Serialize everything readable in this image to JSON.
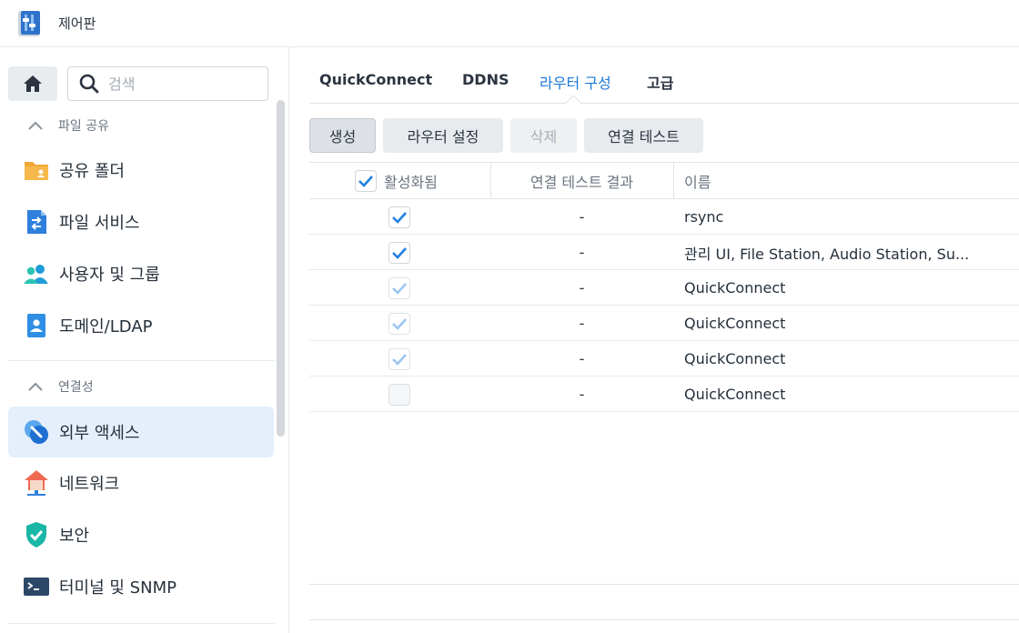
{
  "window": {
    "title": "제어판"
  },
  "sidebar": {
    "search_placeholder": "검색",
    "groups": [
      {
        "label": "파일 공유"
      },
      {
        "label": "연결성"
      }
    ],
    "items": [
      {
        "label": "공유 폴더",
        "icon": "shared-folder-icon"
      },
      {
        "label": "파일 서비스",
        "icon": "file-services-icon"
      },
      {
        "label": "사용자 및 그룹",
        "icon": "user-group-icon"
      },
      {
        "label": "도메인/LDAP",
        "icon": "domain-ldap-icon"
      },
      {
        "label": "외부 액세스",
        "icon": "external-access-icon",
        "active": true
      },
      {
        "label": "네트워크",
        "icon": "network-icon"
      },
      {
        "label": "보안",
        "icon": "security-shield-icon"
      },
      {
        "label": "터미널 및 SNMP",
        "icon": "terminal-icon"
      }
    ]
  },
  "tabs": [
    {
      "label": "QuickConnect"
    },
    {
      "label": "DDNS"
    },
    {
      "label": "라우터 구성",
      "active": true
    },
    {
      "label": "고급"
    }
  ],
  "toolbar": {
    "create": "생성",
    "router_setup": "라우터 설정",
    "delete": "삭제",
    "test_connection": "연결 테스트"
  },
  "table": {
    "headers": {
      "enabled": "활성화됨",
      "test_result": "연결 테스트 결과",
      "name": "이름"
    },
    "rows": [
      {
        "enabled": "checked",
        "result": "-",
        "name": "rsync"
      },
      {
        "enabled": "checked",
        "result": "-",
        "name": "관리 UI, File Station, Audio Station, Su..."
      },
      {
        "enabled": "checked-disabled",
        "result": "-",
        "name": "QuickConnect"
      },
      {
        "enabled": "checked-disabled",
        "result": "-",
        "name": "QuickConnect"
      },
      {
        "enabled": "checked-disabled",
        "result": "-",
        "name": "QuickConnect"
      },
      {
        "enabled": "unchecked-disabled",
        "result": "-",
        "name": "QuickConnect"
      }
    ]
  },
  "colors": {
    "accent": "#1c77d8",
    "active_bg": "#e4effb",
    "check": "#1f7fe0",
    "check_faded": "#9cc6ef"
  }
}
